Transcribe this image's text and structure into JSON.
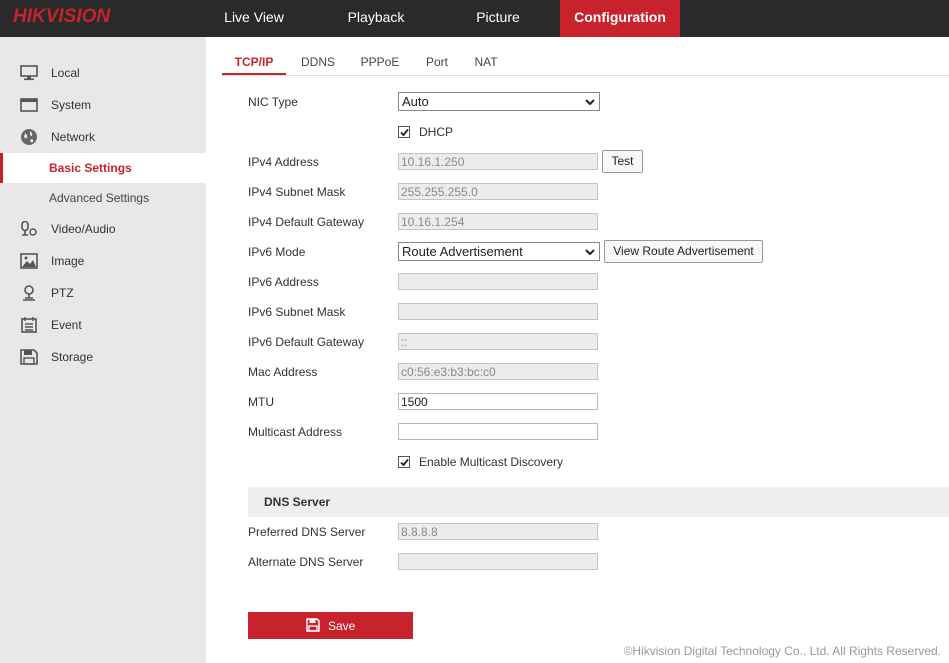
{
  "brand": {
    "logo": "HIKVISION",
    "accent": "#c8232c"
  },
  "topnav": {
    "items": [
      {
        "label": "Live View"
      },
      {
        "label": "Playback"
      },
      {
        "label": "Picture"
      },
      {
        "label": "Configuration",
        "active": true
      }
    ]
  },
  "sidebar": {
    "items": [
      {
        "label": "Local",
        "icon": "monitor-icon"
      },
      {
        "label": "System",
        "icon": "system-icon"
      },
      {
        "label": "Network",
        "icon": "globe-icon"
      },
      {
        "label": "Video/Audio",
        "icon": "microphone-icon"
      },
      {
        "label": "Image",
        "icon": "image-icon"
      },
      {
        "label": "PTZ",
        "icon": "ptz-icon"
      },
      {
        "label": "Event",
        "icon": "calendar-icon"
      },
      {
        "label": "Storage",
        "icon": "disk-icon"
      }
    ],
    "network_sub": [
      {
        "label": "Basic Settings",
        "active": true
      },
      {
        "label": "Advanced Settings"
      }
    ]
  },
  "tabs": [
    {
      "label": "TCP/IP",
      "active": true
    },
    {
      "label": "DDNS"
    },
    {
      "label": "PPPoE"
    },
    {
      "label": "Port"
    },
    {
      "label": "NAT"
    }
  ],
  "form": {
    "nic_type": {
      "label": "NIC Type",
      "value": "Auto"
    },
    "dhcp": {
      "label": "DHCP",
      "checked": true
    },
    "ipv4_address": {
      "label": "IPv4 Address",
      "value": "10.16.1.250"
    },
    "test_button": "Test",
    "ipv4_subnet": {
      "label": "IPv4 Subnet Mask",
      "value": "255.255.255.0"
    },
    "ipv4_gateway": {
      "label": "IPv4 Default Gateway",
      "value": "10.16.1.254"
    },
    "ipv6_mode": {
      "label": "IPv6 Mode",
      "value": "Route Advertisement"
    },
    "view_route_button": "View Route Advertisement",
    "ipv6_address": {
      "label": "IPv6 Address",
      "value": ""
    },
    "ipv6_subnet": {
      "label": "IPv6 Subnet Mask",
      "value": ""
    },
    "ipv6_gateway": {
      "label": "IPv6 Default Gateway",
      "value": "::"
    },
    "mac": {
      "label": "Mac Address",
      "value": "c0:56:e3:b3:bc:c0"
    },
    "mtu": {
      "label": "MTU",
      "value": "1500"
    },
    "multicast": {
      "label": "Multicast Address",
      "value": ""
    },
    "multicast_discovery": {
      "label": "Enable Multicast Discovery",
      "checked": true
    },
    "dns_section": "DNS Server",
    "preferred_dns": {
      "label": "Preferred DNS Server",
      "value": "8.8.8.8"
    },
    "alternate_dns": {
      "label": "Alternate DNS Server",
      "value": ""
    }
  },
  "save_label": "Save",
  "footer": "©Hikvision Digital Technology Co., Ltd. All Rights Reserved."
}
